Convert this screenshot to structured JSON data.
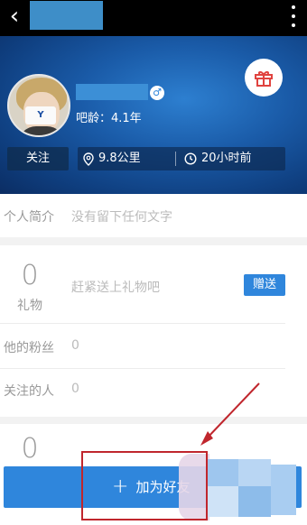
{
  "topbar": {
    "back_icon": "back-arrow-icon",
    "more_icon": "more-vertical-icon"
  },
  "profile": {
    "gender_symbol": "♂",
    "bar_age": "吧龄：4.1年",
    "follow_label": "关注",
    "distance": "9.8公里",
    "last_active": "20小时前",
    "avatar_card_text": "Y"
  },
  "intro": {
    "label": "个人简介",
    "value": "没有留下任何文字"
  },
  "gifts": {
    "count": "0",
    "label": "礼物",
    "prompt": "赶紧送上礼物吧",
    "give_label": "赠送"
  },
  "fans": {
    "label": "他的粉丝",
    "value": "0"
  },
  "following": {
    "label": "关注的人",
    "value": "0"
  },
  "bottom": {
    "count": "0"
  },
  "add_friend": {
    "plus": "+",
    "label": "加为好友"
  },
  "colors": {
    "accent": "#2f86dc",
    "annotation": "#c0262d"
  }
}
